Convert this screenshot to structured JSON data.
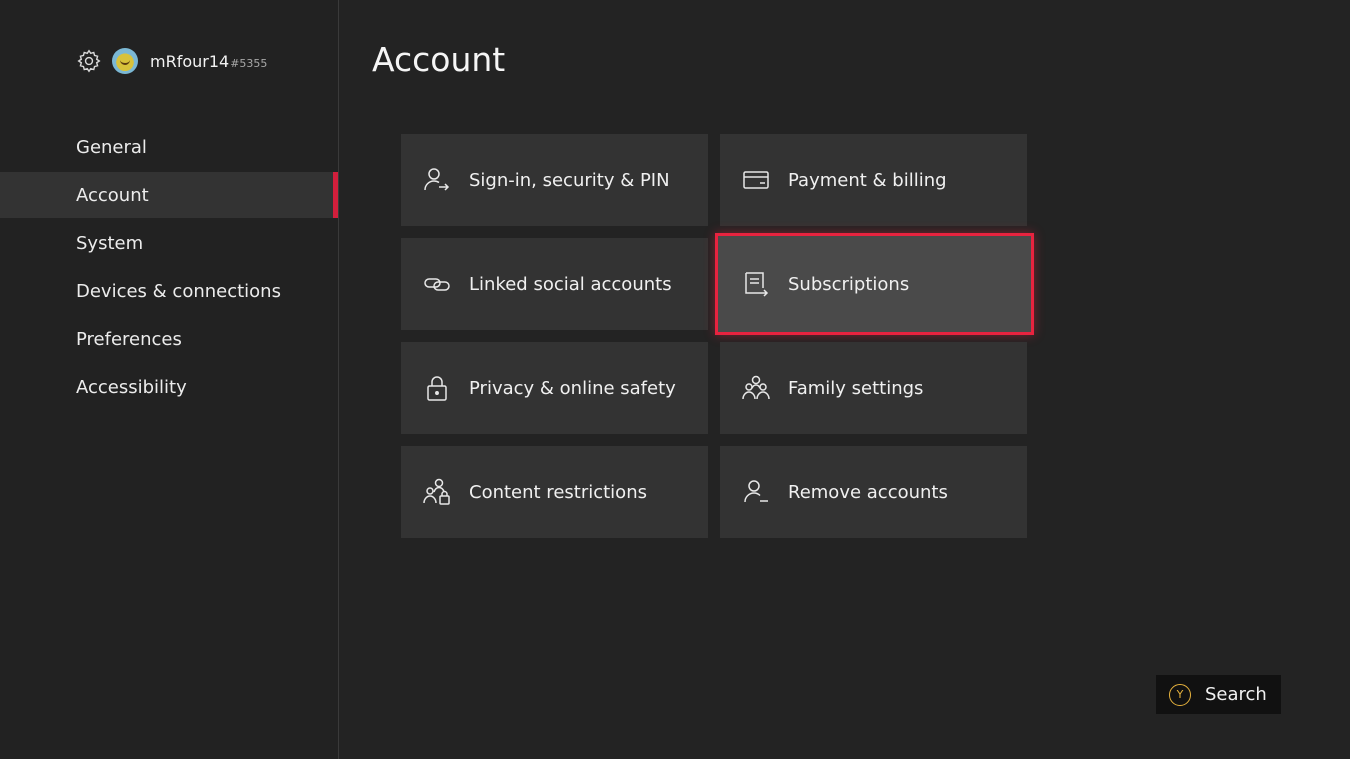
{
  "profile": {
    "gamertag": "mRfour14",
    "suffix": "#5355"
  },
  "nav": {
    "items": [
      {
        "label": "General"
      },
      {
        "label": "Account"
      },
      {
        "label": "System"
      },
      {
        "label": "Devices & connections"
      },
      {
        "label": "Preferences"
      },
      {
        "label": "Accessibility"
      }
    ],
    "selected": "Account"
  },
  "page": {
    "title": "Account"
  },
  "tiles": [
    {
      "label": "Sign-in, security & PIN",
      "icon": "person-arrow-icon"
    },
    {
      "label": "Payment & billing",
      "icon": "credit-card-icon"
    },
    {
      "label": "Linked social accounts",
      "icon": "link-icon"
    },
    {
      "label": "Subscriptions",
      "icon": "subscription-icon"
    },
    {
      "label": "Privacy & online safety",
      "icon": "lock-icon"
    },
    {
      "label": "Family settings",
      "icon": "family-icon"
    },
    {
      "label": "Content restrictions",
      "icon": "people-lock-icon"
    },
    {
      "label": "Remove accounts",
      "icon": "person-remove-icon"
    }
  ],
  "focused_tile": "Subscriptions",
  "footer": {
    "search_button": "Y",
    "search_label": "Search"
  },
  "colors": {
    "accent": "#e8233f",
    "background": "#232323",
    "tile": "#333333",
    "y_button": "#e6b23d"
  }
}
